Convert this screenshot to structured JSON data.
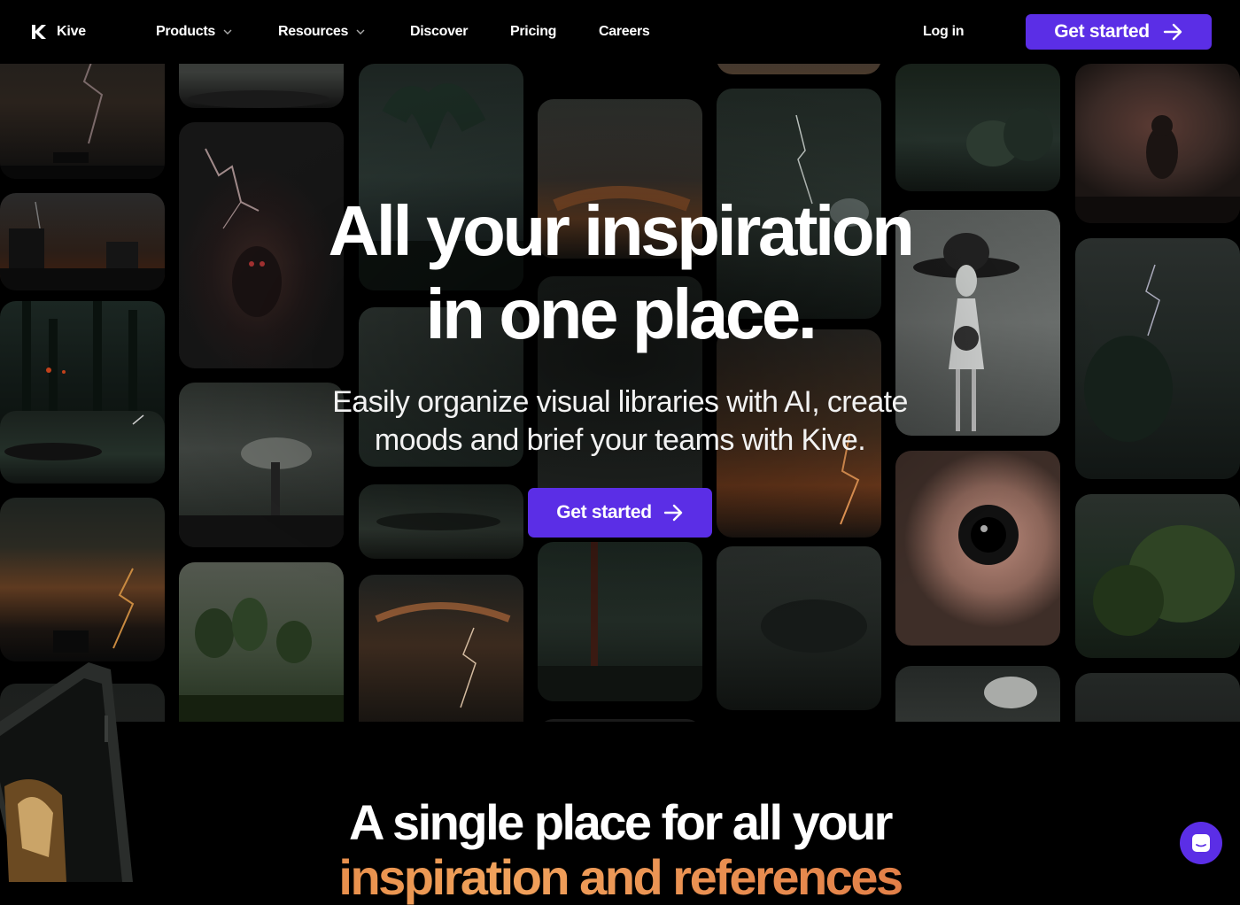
{
  "nav": {
    "brand": "Kive",
    "items": [
      {
        "label": "Products",
        "has_dropdown": true
      },
      {
        "label": "Resources",
        "has_dropdown": true
      },
      {
        "label": "Discover",
        "has_dropdown": false
      },
      {
        "label": "Pricing",
        "has_dropdown": false
      },
      {
        "label": "Careers",
        "has_dropdown": false
      }
    ],
    "login_label": "Log in",
    "cta_label": "Get started"
  },
  "hero": {
    "title_line1": "All your inspiration",
    "title_line2": "in one place.",
    "subtitle_line1": "Easily organize visual libraries with AI, create",
    "subtitle_line2": "moods and brief your teams with Kive.",
    "cta_label": "Get started"
  },
  "section": {
    "title_line1": "A single place for all your",
    "title_line2": "inspiration and references"
  },
  "colors": {
    "accent": "#5b2ee6",
    "background": "#000000",
    "highlight_gradient_start": "#d86a2c",
    "highlight_gradient_end": "#f0a15b"
  },
  "icons": [
    "kive-logo-icon",
    "chevron-down-icon",
    "arrow-right-icon",
    "chat-bubble-icon"
  ]
}
